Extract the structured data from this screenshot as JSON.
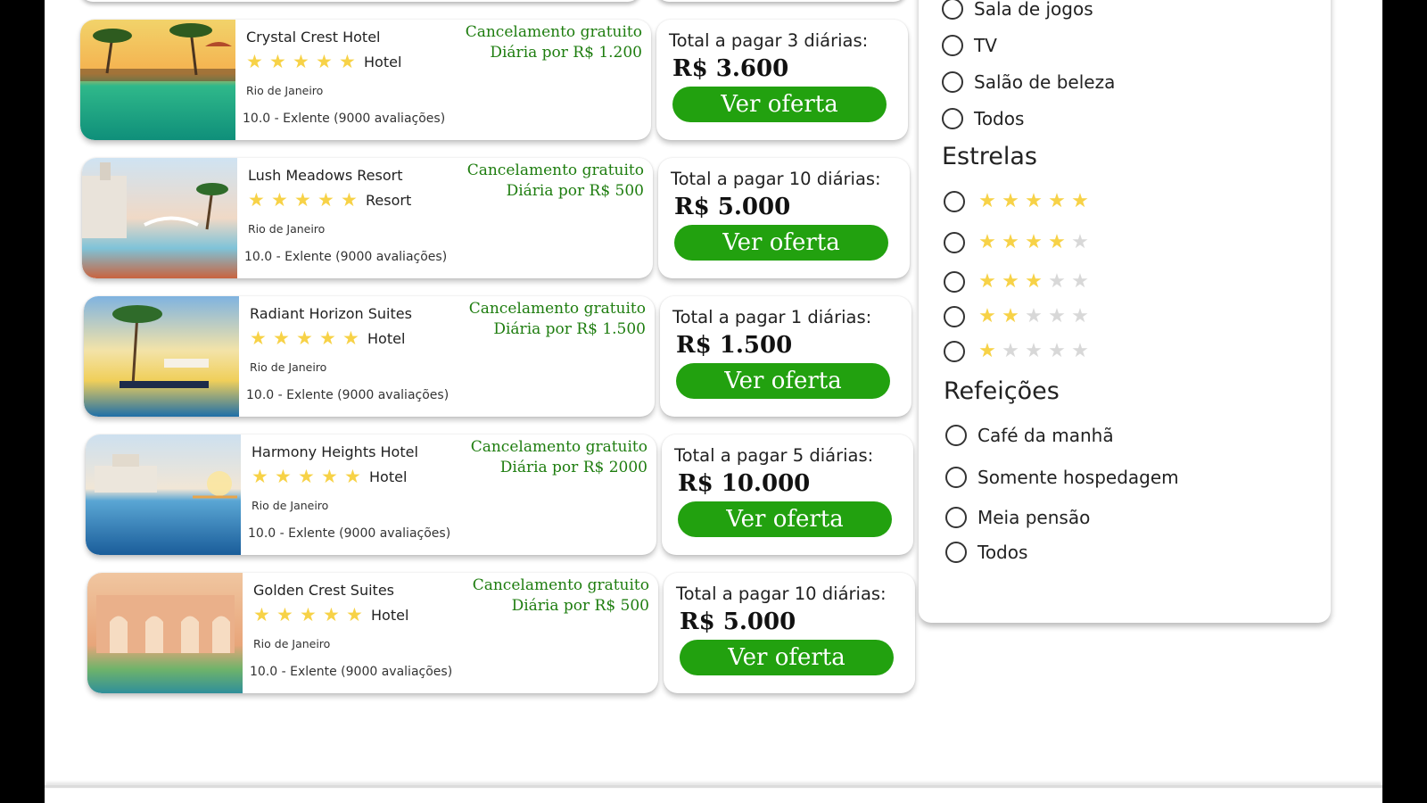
{
  "hotels": [
    {
      "name": "Crystal Crest Hotel",
      "type": "Hotel",
      "stars": 5,
      "city": "Rio de Janeiro",
      "rating": "10.0 - Exlente (9000 avaliações)",
      "cancel": "Cancelamento gratuito",
      "daily": "Diária por R$ 1.200",
      "total_label": "Total a pagar 3 diárias:",
      "total": "R$ 3.600",
      "cta": "Ver oferta"
    },
    {
      "name": "Lush Meadows Resort",
      "type": "Resort",
      "stars": 5,
      "city": "Rio de Janeiro",
      "rating": "10.0 - Exlente (9000 avaliações)",
      "cancel": "Cancelamento gratuito",
      "daily": "Diária por R$ 500",
      "total_label": "Total a pagar 10 diárias:",
      "total": "R$ 5.000",
      "cta": "Ver oferta"
    },
    {
      "name": "Radiant Horizon Suites",
      "type": "Hotel",
      "stars": 5,
      "city": "Rio de Janeiro",
      "rating": "10.0 - Exlente (9000 avaliações)",
      "cancel": "Cancelamento gratuito",
      "daily": "Diária por R$ 1.500",
      "total_label": "Total a pagar 1 diárias:",
      "total": "R$ 1.500",
      "cta": "Ver oferta"
    },
    {
      "name": "Harmony Heights Hotel",
      "type": "Hotel",
      "stars": 5,
      "city": "Rio de Janeiro",
      "rating": "10.0 - Exlente (9000 avaliações)",
      "cancel": "Cancelamento gratuito",
      "daily": "Diária por R$ 2000",
      "total_label": "Total a pagar 5 diárias:",
      "total": "R$ 10.000",
      "cta": "Ver oferta"
    },
    {
      "name": "Golden Crest Suites",
      "type": "Hotel",
      "stars": 5,
      "city": "Rio de Janeiro",
      "rating": "10.0 - Exlente (9000 avaliações)",
      "cancel": "Cancelamento gratuito",
      "daily": "Diária por R$ 500",
      "total_label": "Total a pagar 10 diárias:",
      "total": "R$ 5.000",
      "cta": "Ver oferta"
    }
  ],
  "filters": {
    "amenities": [
      "Sala de jogos",
      "TV",
      "Salão de beleza",
      "Todos"
    ],
    "stars_heading": "Estrelas",
    "star_levels": [
      5,
      4,
      3,
      2,
      1
    ],
    "meals_heading": "Refeições",
    "meals": [
      "Café da manhã",
      "Somente hospedagem",
      "Meia pensão",
      "Todos"
    ]
  },
  "colors": {
    "accent_green": "#22a10f",
    "cancel_green": "#1e7d0f",
    "star_gold": "#f7d247",
    "star_grey": "#d8d8d8"
  }
}
